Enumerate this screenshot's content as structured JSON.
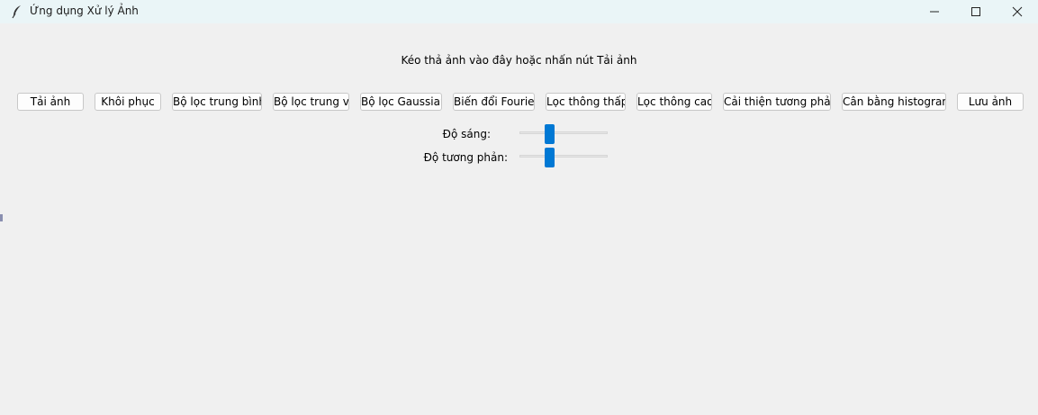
{
  "window": {
    "title": "Ứng dụng Xử lý Ảnh",
    "icon": "feather-icon"
  },
  "hint": "Kéo thả ảnh vào đây hoặc nhấn nút Tải ảnh",
  "toolbar": {
    "buttons": [
      {
        "label": "Tải ảnh"
      },
      {
        "label": "Khôi phục"
      },
      {
        "label": "Bộ lọc trung bình"
      },
      {
        "label": "Bộ lọc trung vị"
      },
      {
        "label": "Bộ lọc Gaussian"
      },
      {
        "label": "Biến đổi Fourier"
      },
      {
        "label": "Lọc thông thấp"
      },
      {
        "label": "Lọc thông cao"
      },
      {
        "label": "Cải thiện tương phản"
      },
      {
        "label": "Cân bằng histogram"
      },
      {
        "label": "Lưu ảnh"
      }
    ]
  },
  "adjustments": {
    "brightness": {
      "label": "Độ sáng:",
      "value_fraction": 0.34
    },
    "contrast": {
      "label": "Độ tương phản:",
      "value_fraction": 0.34
    }
  },
  "colors": {
    "accent": "#0078d4",
    "background": "#f0f0f0",
    "titlebar": "#eaf5f7"
  }
}
